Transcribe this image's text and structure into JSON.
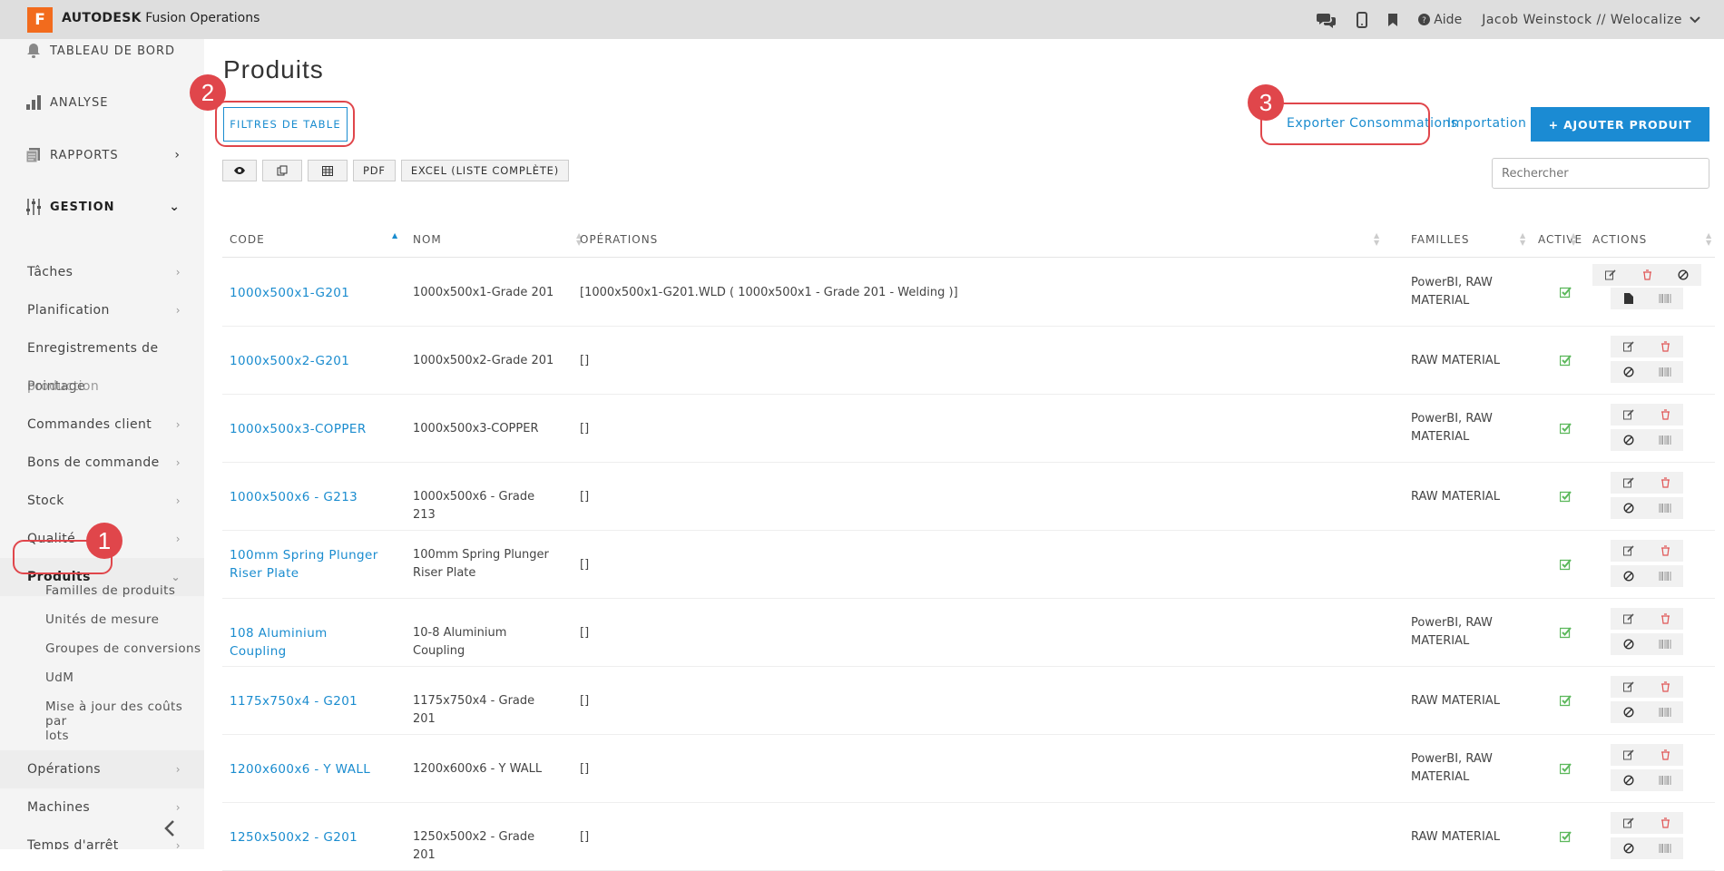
{
  "app": {
    "logo_letter": "F",
    "brand_bold": "AUTODESK",
    "brand_rest": " Fusion Operations"
  },
  "topbar": {
    "help_label": "Aide",
    "user": "Jacob Weinstock // Welocalize"
  },
  "sidebar": {
    "sections": [
      {
        "label": "TABLEAU DE BORD",
        "icon": "bell-icon"
      },
      {
        "label": "ANALYSE",
        "icon": "bar-chart-icon"
      },
      {
        "label": "RAPPORTS",
        "icon": "reports-icon"
      },
      {
        "label": "GESTION",
        "icon": "sliders-icon"
      }
    ],
    "items": [
      {
        "label": "Tâches"
      },
      {
        "label": "Planification"
      },
      {
        "label": "Enregistrements de"
      },
      {
        "label": "production"
      },
      {
        "label": "Pointage"
      },
      {
        "label": "Commandes client"
      },
      {
        "label": "Bons de commande"
      },
      {
        "label": "Stock"
      },
      {
        "label": "Qualité"
      },
      {
        "label": "Produits"
      },
      {
        "label": "Opérations"
      },
      {
        "label": "Machines"
      },
      {
        "label": "Temps d'arrêt"
      }
    ],
    "sub_items": [
      "Familles de produits",
      "Unités de mesure",
      "Groupes de conversions",
      "UdM",
      "Mise à jour des coûts par",
      "lots"
    ],
    "collapse_icon": "chevron-left-icon"
  },
  "main": {
    "title": "Produits",
    "filters_label": "FILTRES DE TABLE",
    "export_label": "Exporter Consommations",
    "import_label": "Importation",
    "add_label": "+ AJOUTER PRODUIT",
    "tools": {
      "pdf": "PDF",
      "excel": "EXCEL (LISTE COMPLÈTE)"
    },
    "search_placeholder": "Rechercher"
  },
  "table": {
    "headers": {
      "code": "CODE",
      "nom": "NOM",
      "operations": "OPÉRATIONS",
      "familles": "FAMILLES",
      "active": "ACTIVE",
      "actions": "ACTIONS"
    },
    "rows": [
      {
        "code": "1000x500x1-G201",
        "nom": "1000x500x1-Grade 201",
        "ops": "[1000x500x1-G201.WLD ( 1000x500x1 - Grade 201 - Welding )]",
        "fam": "PowerBI, RAW MATERIAL"
      },
      {
        "code": "1000x500x2-G201",
        "nom": "1000x500x2-Grade 201",
        "ops": "[]",
        "fam": "RAW MATERIAL"
      },
      {
        "code": "1000x500x3-COPPER",
        "nom": "1000x500x3-COPPER",
        "ops": "[]",
        "fam": "PowerBI, RAW MATERIAL"
      },
      {
        "code": "1000x500x6 - G213",
        "nom": "1000x500x6 - Grade 213",
        "ops": "[]",
        "fam": "RAW MATERIAL"
      },
      {
        "code": "100mm Spring Plunger Riser Plate",
        "nom": "100mm Spring Plunger Riser Plate",
        "ops": "[]",
        "fam": ""
      },
      {
        "code": "108 Aluminium Coupling",
        "nom": "10-8 Aluminium Coupling",
        "ops": "[]",
        "fam": "PowerBI, RAW MATERIAL"
      },
      {
        "code": "1175x750x4 - G201",
        "nom": "1175x750x4 - Grade 201",
        "ops": "[]",
        "fam": "RAW MATERIAL"
      },
      {
        "code": "1200x600x6 - Y WALL",
        "nom": "1200x600x6 - Y WALL",
        "ops": "[]",
        "fam": "PowerBI, RAW MATERIAL"
      },
      {
        "code": "1250x500x2 - G201",
        "nom": "1250x500x2 - Grade 201",
        "ops": "[]",
        "fam": "RAW MATERIAL"
      }
    ]
  },
  "callouts": [
    "1",
    "2",
    "3"
  ],
  "colors": {
    "accent": "#1a8ccf",
    "callout": "#e0464b",
    "check": "#5cb85c",
    "delete": "#e05555",
    "logo": "#f26b1d"
  }
}
